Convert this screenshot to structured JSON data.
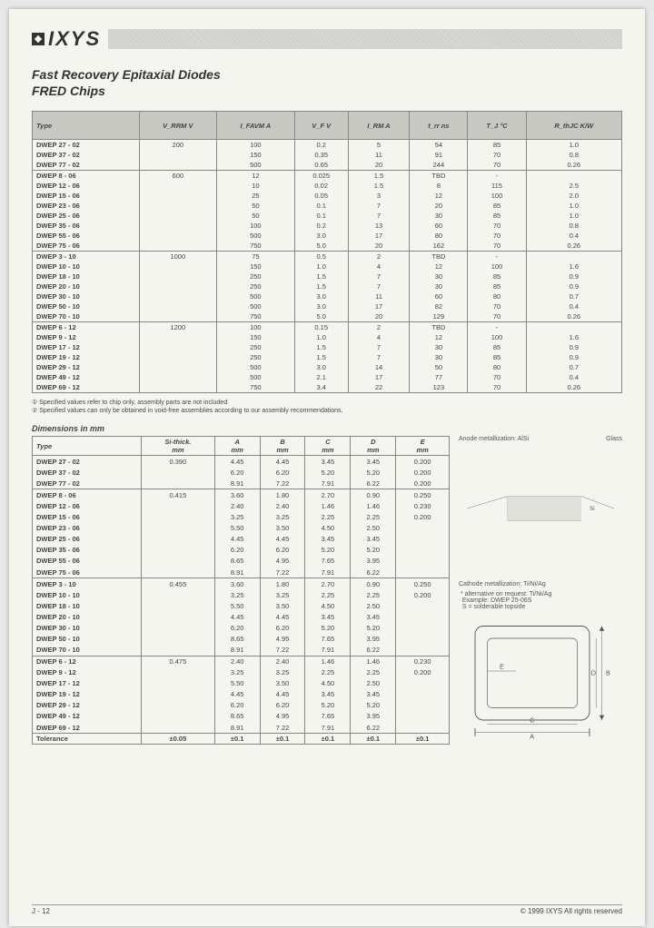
{
  "header": {
    "brand": "IXYS",
    "title": "Fast Recovery Epitaxial Diodes",
    "subtitle": "FRED Chips"
  },
  "table1": {
    "headers": [
      "Type",
      "V_RRM V",
      "I_FAVM A",
      "V_F V",
      "I_RM A",
      "t_rr ns",
      "T_J °C",
      "R_thJC K/W"
    ],
    "groups": [
      [
        [
          "DWEP  27 - 02",
          "200",
          "100",
          "0.2",
          "5",
          "54",
          "85",
          "1.0"
        ],
        [
          "DWEP  37 - 02",
          "",
          "150",
          "0.35",
          "11",
          "91",
          "70",
          "0.8"
        ],
        [
          "DWEP  77 - 02",
          "",
          "500",
          "0.65",
          "20",
          "244",
          "70",
          "0.26"
        ]
      ],
      [
        [
          "DWEP   8 - 06",
          "600",
          "12",
          "0.025",
          "1.5",
          "TBD",
          "-",
          ""
        ],
        [
          "DWEP  12 - 06",
          "",
          "10",
          "0.02",
          "1.5",
          "8",
          "115",
          "2.5"
        ],
        [
          "DWEP  15 - 06",
          "",
          "25",
          "0.05",
          "3",
          "12",
          "100",
          "2.0"
        ],
        [
          "DWEP  23 - 06",
          "",
          "50",
          "0.1",
          "7",
          "20",
          "85",
          "1.0"
        ],
        [
          "DWEP  25 - 06",
          "",
          "50",
          "0.1",
          "7",
          "30",
          "85",
          "1.0"
        ],
        [
          "DWEP  35 - 06",
          "",
          "100",
          "0.2",
          "13",
          "60",
          "70",
          "0.8"
        ],
        [
          "DWEP  55 - 06",
          "",
          "500",
          "3.0",
          "17",
          "80",
          "70",
          "0.4"
        ],
        [
          "DWEP  75 - 06",
          "",
          "750",
          "5.0",
          "20",
          "162",
          "70",
          "0.26"
        ]
      ],
      [
        [
          "DWEP   3 - 10",
          "1000",
          "75",
          "0.5",
          "2",
          "TBD",
          "-",
          ""
        ],
        [
          "DWEP  10 - 10",
          "",
          "150",
          "1.0",
          "4",
          "12",
          "100",
          "1.6"
        ],
        [
          "DWEP  18 - 10",
          "",
          "250",
          "1.5",
          "7",
          "30",
          "85",
          "0.9"
        ],
        [
          "DWEP  20 - 10",
          "",
          "250",
          "1.5",
          "7",
          "30",
          "85",
          "0.9"
        ],
        [
          "DWEP  30 - 10",
          "",
          "500",
          "3.0",
          "11",
          "60",
          "80",
          "0.7"
        ],
        [
          "DWEP  50 - 10",
          "",
          "500",
          "3.0",
          "17",
          "82",
          "70",
          "0.4"
        ],
        [
          "DWEP  70 - 10",
          "",
          "750",
          "5.0",
          "20",
          "129",
          "70",
          "0.26"
        ]
      ],
      [
        [
          "DWEP   6 - 12",
          "1200",
          "100",
          "0.15",
          "2",
          "TBD",
          "-",
          ""
        ],
        [
          "DWEP   9 - 12",
          "",
          "150",
          "1.0",
          "4",
          "12",
          "100",
          "1.6"
        ],
        [
          "DWEP  17 - 12",
          "",
          "250",
          "1.5",
          "7",
          "30",
          "85",
          "0.9"
        ],
        [
          "DWEP  19 - 12",
          "",
          "250",
          "1.5",
          "7",
          "30",
          "85",
          "0.9"
        ],
        [
          "DWEP  29 - 12",
          "",
          "500",
          "3.0",
          "14",
          "50",
          "80",
          "0.7"
        ],
        [
          "DWEP  49 - 12",
          "",
          "500",
          "2.1",
          "17",
          "77",
          "70",
          "0.4"
        ],
        [
          "DWEP  69 - 12",
          "",
          "750",
          "3.4",
          "22",
          "123",
          "70",
          "0.26"
        ]
      ]
    ]
  },
  "notes": [
    "① Specified values refer to chip only, assembly parts are not included.",
    "② Specified values can only be obtained in void-free assemblies according to our assembly recommendations."
  ],
  "dimensions": {
    "heading": "Dimensions in mm",
    "headers": [
      "Type",
      "Si-thick. mm",
      "A mm",
      "B mm",
      "C mm",
      "D mm",
      "E mm"
    ],
    "groups": [
      [
        [
          "DWEP  27 - 02",
          "0.390",
          "4.45",
          "4.45",
          "3.45",
          "3.45",
          "0.200"
        ],
        [
          "DWEP  37 - 02",
          "",
          "6.20",
          "6.20",
          "5.20",
          "5.20",
          "0.200"
        ],
        [
          "DWEP  77 - 02",
          "",
          "8.91",
          "7.22",
          "7.91",
          "6.22",
          "0.200"
        ]
      ],
      [
        [
          "DWEP   8 - 06",
          "0.415",
          "3.60",
          "1.80",
          "2.70",
          "0.90",
          "0.250"
        ],
        [
          "DWEP  12 - 06",
          "",
          "2.40",
          "2.40",
          "1.46",
          "1.46",
          "0.230"
        ],
        [
          "DWEP  15 - 06",
          "",
          "3.25",
          "3.25",
          "2.25",
          "2.25",
          "0.200"
        ],
        [
          "DWEP  23 - 06",
          "",
          "5.50",
          "3.50",
          "4.50",
          "2.50",
          ""
        ],
        [
          "DWEP  25 - 06",
          "",
          "4.45",
          "4.45",
          "3.45",
          "3.45",
          ""
        ],
        [
          "DWEP  35 - 06",
          "",
          "6.20",
          "6.20",
          "5.20",
          "5.20",
          ""
        ],
        [
          "DWEP  55 - 06",
          "",
          "8.65",
          "4.95",
          "7.65",
          "3.95",
          ""
        ],
        [
          "DWEP  75 - 06",
          "",
          "8.91",
          "7.22",
          "7.91",
          "6.22",
          ""
        ]
      ],
      [
        [
          "DWEP   3 - 10",
          "0.455",
          "3.60",
          "1.80",
          "2.70",
          "0.90",
          "0.250"
        ],
        [
          "DWEP  10 - 10",
          "",
          "3.25",
          "3.25",
          "2.25",
          "2.25",
          "0.200"
        ],
        [
          "DWEP  18 - 10",
          "",
          "5.50",
          "3.50",
          "4.50",
          "2.50",
          ""
        ],
        [
          "DWEP  20 - 10",
          "",
          "4.45",
          "4.45",
          "3.45",
          "3.45",
          ""
        ],
        [
          "DWEP  30 - 10",
          "",
          "6.20",
          "6.20",
          "5.20",
          "5.20",
          ""
        ],
        [
          "DWEP  50 - 10",
          "",
          "8.65",
          "4.95",
          "7.65",
          "3.95",
          ""
        ],
        [
          "DWEP  70 - 10",
          "",
          "8.91",
          "7.22",
          "7.91",
          "6.22",
          ""
        ]
      ],
      [
        [
          "DWEP   6 - 12",
          "0.475",
          "2.40",
          "2.40",
          "1.46",
          "1.46",
          "0.230"
        ],
        [
          "DWEP   9 - 12",
          "",
          "3.25",
          "3.25",
          "2.25",
          "2.25",
          "0.200"
        ],
        [
          "DWEP  17 - 12",
          "",
          "5.50",
          "3.50",
          "4.50",
          "2.50",
          ""
        ],
        [
          "DWEP  19 - 12",
          "",
          "4.45",
          "4.45",
          "3.45",
          "3.45",
          ""
        ],
        [
          "DWEP  29 - 12",
          "",
          "6.20",
          "6.20",
          "5.20",
          "5.20",
          ""
        ],
        [
          "DWEP  49 - 12",
          "",
          "8.65",
          "4.95",
          "7.65",
          "3.95",
          ""
        ],
        [
          "DWEP  69 - 12",
          "",
          "8.91",
          "7.22",
          "7.91",
          "6.22",
          ""
        ]
      ]
    ],
    "tolerance": [
      "Tolerance",
      "±0.05",
      "±0.1",
      "±0.1",
      "±0.1",
      "±0.1",
      "±0.1"
    ]
  },
  "diagram": {
    "anode_label": "Anode metallization: AlSi",
    "glass_label": "Glass",
    "cathode_label": "Cathode metallization: Ti/Ni/Ag",
    "alt_label": "* alternative on request: Ti/Ni/Ag",
    "example": "Example: DWEP 25-06S",
    "s_label": "S = solderable topside"
  },
  "footer": {
    "page": "J - 12",
    "copyright": "© 1999 IXYS All rights reserved"
  }
}
